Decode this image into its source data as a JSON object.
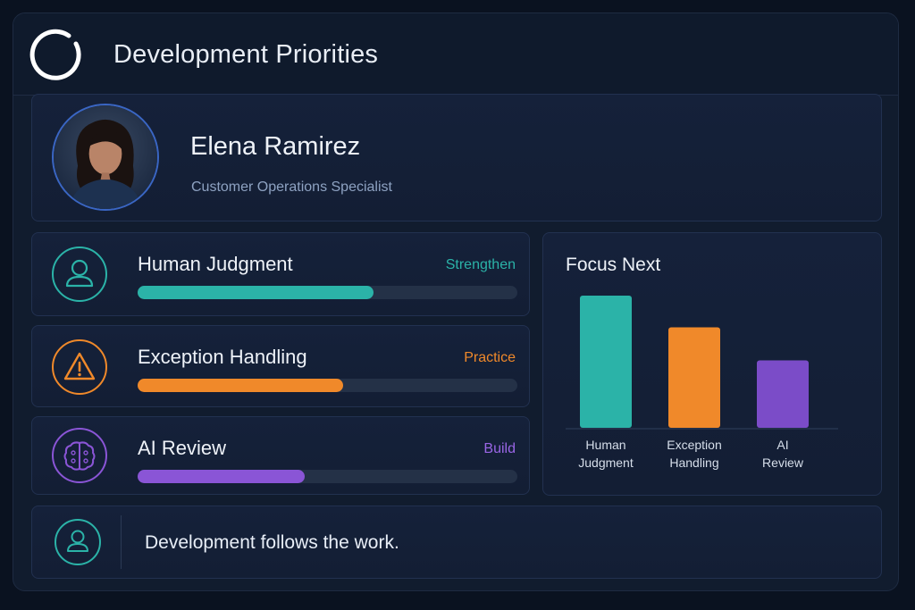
{
  "header": {
    "title": "Development Priorities",
    "logo_icon": "ring-logo-icon"
  },
  "profile": {
    "name": "Elena Ramirez",
    "role": "Customer Operations Specialist",
    "avatar_icon": "user-photo"
  },
  "skills": [
    {
      "label": "Human Judgment",
      "status": "Strengthen",
      "progress": 0.62,
      "color": "#2bb3a8",
      "icon": "person-icon"
    },
    {
      "label": "Exception Handling",
      "status": "Practice",
      "progress": 0.54,
      "color": "#f0892a",
      "icon": "warning-icon"
    },
    {
      "label": "AI Review",
      "status": "Build",
      "progress": 0.44,
      "color": "#8a55d6",
      "icon": "brain-icon"
    }
  ],
  "focus": {
    "title": "Focus Next",
    "chart_data": {
      "type": "bar",
      "title": "Focus Next",
      "categories": [
        [
          "Human",
          "Judgment"
        ],
        [
          "Exception",
          "Handling"
        ],
        [
          "AI",
          "Review"
        ]
      ],
      "values": [
        100,
        76,
        51
      ],
      "colors": [
        "#2bb3a8",
        "#f0892a",
        "#7b4cc8"
      ],
      "ylim": [
        0,
        100
      ],
      "grid": false
    }
  },
  "footer": {
    "text": "Development follows the work.",
    "icon": "person-icon"
  }
}
